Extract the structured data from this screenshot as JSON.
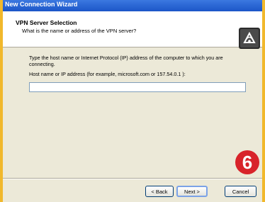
{
  "window": {
    "title": "New Connection Wizard"
  },
  "header": {
    "title": "VPN Server Selection",
    "subtitle": "What is the name or address of the VPN server?",
    "icon": "vpn-wizard-icon"
  },
  "main": {
    "description": "Type the host name or Internet Protocol (IP) address of the computer to which you are connecting.",
    "field_label": "Host name or IP address (for example, microsoft.com or 157.54.0.1 ):",
    "host_value": ""
  },
  "overlay": {
    "step_number": "6",
    "color": "#d8232a"
  },
  "buttons": {
    "back": "< Back",
    "next": "Next >",
    "cancel": "Cancel"
  },
  "colors": {
    "background": "#f1b82c",
    "titlebar": "#1c56c8",
    "dialog": "#ece9d8"
  }
}
